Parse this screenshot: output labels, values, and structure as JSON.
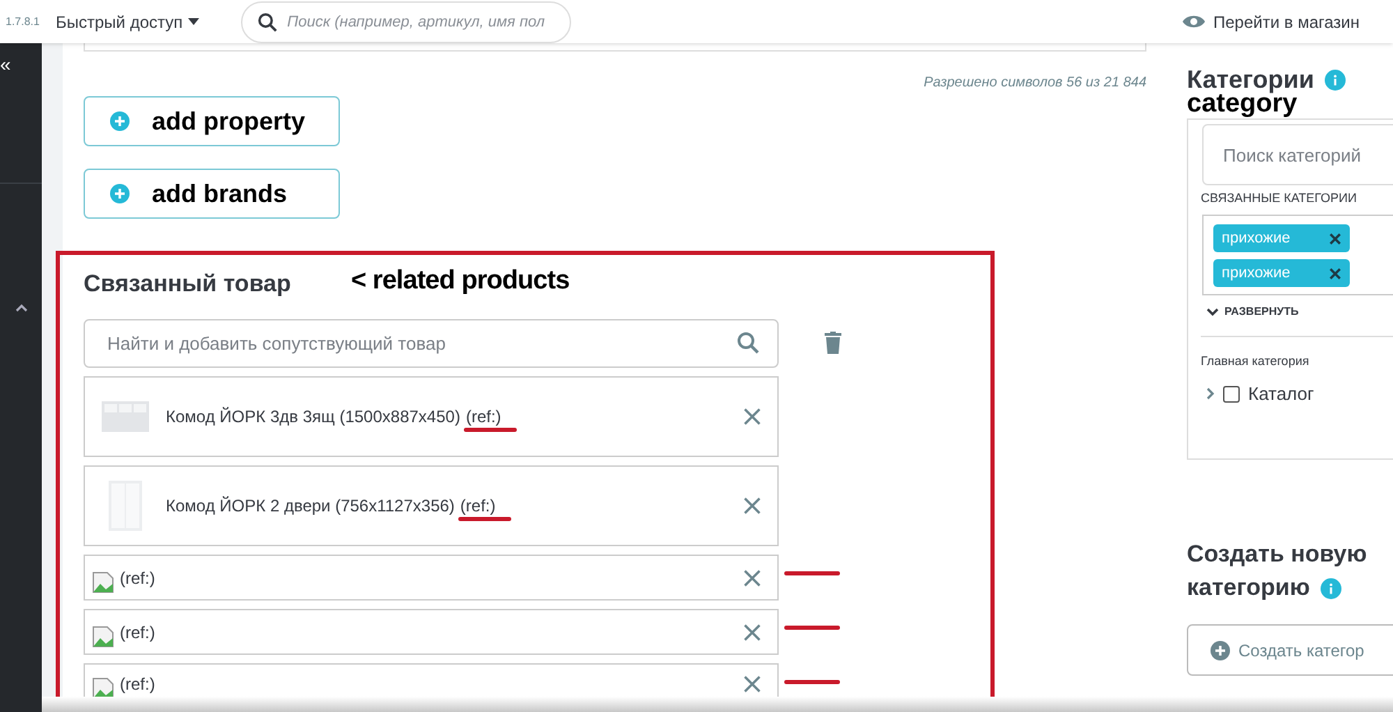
{
  "top_bar": {
    "version": "1.7.8.1",
    "quick_access": "Быстрый доступ",
    "search": {
      "placeholder": "Поиск (например, артикул, имя пол"
    },
    "shop_link": "Перейти в магазин"
  },
  "sidebar": {
    "collapse": "«"
  },
  "char_count": "Разрешено символов 56 из 21 844",
  "add_buttons": [
    {
      "annotation": "add property"
    },
    {
      "annotation": "add brands"
    }
  ],
  "related": {
    "title": "Связанный товар",
    "annotation": "< related products",
    "highlighted": true,
    "search": {
      "placeholder": "Найти и добавить сопутствующий товар"
    },
    "products": [
      {
        "kind": "thumbnail",
        "name": "Комод ЙОРК 3дв 3ящ (1500x887x450)",
        "ref": "(ref:)",
        "underlined": true,
        "dashed": false
      },
      {
        "kind": "tall_thumbnail",
        "name": "Комод ЙОРК 2 двери (756x1127x356)",
        "ref": "(ref:)",
        "underlined": true,
        "dashed": false
      },
      {
        "kind": "broken_image",
        "ref": "(ref:)",
        "underlined": false,
        "dashed": true
      },
      {
        "kind": "broken_image",
        "ref": "(ref:)",
        "underlined": false,
        "dashed": true
      },
      {
        "kind": "broken_image",
        "ref": "(ref:)",
        "underlined": false,
        "dashed": true
      }
    ]
  },
  "categories": {
    "title": "Категории",
    "annotation": "category",
    "search": {
      "placeholder": "Поиск категорий"
    },
    "linked_label": "СВЯЗАННЫЕ КАТЕГОРИИ",
    "tags": [
      "прихожие",
      "прихожие"
    ],
    "expand": "РАЗВЕРНУТЬ",
    "main_label": "Главная категория",
    "tree": [
      {
        "label": "Каталог",
        "checked": false,
        "expanded": false
      }
    ]
  },
  "new_category": {
    "title_lines": [
      "Создать новую",
      "категорию"
    ],
    "button": "Создать категор"
  }
}
